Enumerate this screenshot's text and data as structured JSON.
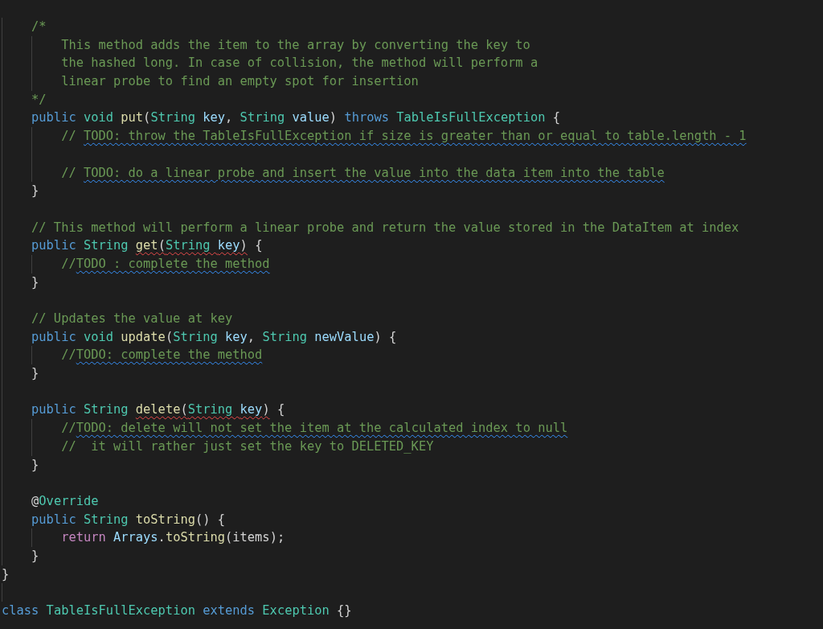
{
  "editor": {
    "lines": [
      {
        "tokens": [
          {
            "text": "    /*",
            "kind": "comment",
            "squiggle": false
          }
        ]
      },
      {
        "tokens": [
          {
            "text": "        This method adds the item to the array by converting the key to",
            "kind": "comment",
            "squiggle": false
          }
        ]
      },
      {
        "tokens": [
          {
            "text": "        the hashed long. In case of collision, the method will perform a",
            "kind": "comment",
            "squiggle": false
          }
        ]
      },
      {
        "tokens": [
          {
            "text": "        linear probe to find an empty spot for insertion",
            "kind": "comment",
            "squiggle": false
          }
        ]
      },
      {
        "tokens": [
          {
            "text": "    */",
            "kind": "comment",
            "squiggle": false
          }
        ]
      },
      {
        "tokens": [
          {
            "text": "    public ",
            "kind": "keyword",
            "squiggle": false
          },
          {
            "text": "void ",
            "kind": "type",
            "squiggle": false
          },
          {
            "text": "put",
            "kind": "function",
            "squiggle": false
          },
          {
            "text": "(",
            "kind": "plain",
            "squiggle": false
          },
          {
            "text": "String ",
            "kind": "type",
            "squiggle": false
          },
          {
            "text": "key",
            "kind": "variable",
            "squiggle": false
          },
          {
            "text": ", ",
            "kind": "plain",
            "squiggle": false
          },
          {
            "text": "String ",
            "kind": "type",
            "squiggle": false
          },
          {
            "text": "value",
            "kind": "variable",
            "squiggle": false
          },
          {
            "text": ") ",
            "kind": "plain",
            "squiggle": false
          },
          {
            "text": "throws ",
            "kind": "keyword",
            "squiggle": false
          },
          {
            "text": "TableIsFullException",
            "kind": "type",
            "squiggle": false
          },
          {
            "text": " {",
            "kind": "plain",
            "squiggle": false
          }
        ]
      },
      {
        "tokens": [
          {
            "text": "        // ",
            "kind": "comment",
            "squiggle": false
          },
          {
            "text": "TODO: throw the TableIsFullException if size is greater than or equal to table.length - 1",
            "kind": "comment",
            "squiggle": true,
            "error": false
          }
        ]
      },
      {
        "in_method": true
      },
      {
        "tokens": [
          {
            "text": "        // ",
            "kind": "comment",
            "squiggle": false
          },
          {
            "text": "TODO: do a linear probe and insert the value into the data item into the table",
            "kind": "comment",
            "squiggle": true,
            "error": false
          }
        ]
      },
      {
        "tokens": [
          {
            "text": "    }",
            "kind": "plain",
            "squiggle": false
          }
        ]
      },
      {
        "in_method": false
      },
      {
        "tokens": [
          {
            "text": "    // This method will perform a linear probe and return the value stored in the DataItem at index",
            "kind": "comment",
            "squiggle": false
          }
        ]
      },
      {
        "tokens": [
          {
            "text": "    public ",
            "kind": "keyword",
            "squiggle": false
          },
          {
            "text": "String ",
            "kind": "type",
            "squiggle": false
          },
          {
            "text": "get",
            "kind": "function",
            "squiggle": true,
            "error": true
          },
          {
            "text": "(",
            "kind": "plain",
            "squiggle": true,
            "error": true
          },
          {
            "text": "String ",
            "kind": "type",
            "squiggle": true,
            "error": true
          },
          {
            "text": "key",
            "kind": "variable",
            "squiggle": true,
            "error": true
          },
          {
            "text": ")",
            "kind": "plain",
            "squiggle": true,
            "error": true
          },
          {
            "text": " {",
            "kind": "plain",
            "squiggle": false
          }
        ]
      },
      {
        "tokens": [
          {
            "text": "        //",
            "kind": "comment",
            "squiggle": false
          },
          {
            "text": "TODO : complete the method",
            "kind": "comment",
            "squiggle": true,
            "error": false
          }
        ]
      },
      {
        "tokens": [
          {
            "text": "    }",
            "kind": "plain",
            "squiggle": false
          }
        ]
      },
      {
        "in_method": false
      },
      {
        "tokens": [
          {
            "text": "    // Updates the value at key",
            "kind": "comment",
            "squiggle": false
          }
        ]
      },
      {
        "tokens": [
          {
            "text": "    public ",
            "kind": "keyword",
            "squiggle": false
          },
          {
            "text": "void ",
            "kind": "type",
            "squiggle": false
          },
          {
            "text": "update",
            "kind": "function",
            "squiggle": false
          },
          {
            "text": "(",
            "kind": "plain",
            "squiggle": false
          },
          {
            "text": "String ",
            "kind": "type",
            "squiggle": false
          },
          {
            "text": "key",
            "kind": "variable",
            "squiggle": false
          },
          {
            "text": ", ",
            "kind": "plain",
            "squiggle": false
          },
          {
            "text": "String ",
            "kind": "type",
            "squiggle": false
          },
          {
            "text": "newValue",
            "kind": "variable",
            "squiggle": false
          },
          {
            "text": ") {",
            "kind": "plain",
            "squiggle": false
          }
        ]
      },
      {
        "tokens": [
          {
            "text": "        //",
            "kind": "comment",
            "squiggle": false
          },
          {
            "text": "TODO: complete the method",
            "kind": "comment",
            "squiggle": true,
            "error": false
          }
        ]
      },
      {
        "tokens": [
          {
            "text": "    }",
            "kind": "plain",
            "squiggle": false
          }
        ]
      },
      {
        "in_method": false
      },
      {
        "tokens": [
          {
            "text": "    public ",
            "kind": "keyword",
            "squiggle": false
          },
          {
            "text": "String ",
            "kind": "type",
            "squiggle": false
          },
          {
            "text": "delete",
            "kind": "function",
            "squiggle": true,
            "error": true
          },
          {
            "text": "(",
            "kind": "plain",
            "squiggle": true,
            "error": true
          },
          {
            "text": "String ",
            "kind": "type",
            "squiggle": true,
            "error": true
          },
          {
            "text": "key",
            "kind": "variable",
            "squiggle": true,
            "error": true
          },
          {
            "text": ")",
            "kind": "plain",
            "squiggle": true,
            "error": true
          },
          {
            "text": " {",
            "kind": "plain",
            "squiggle": false
          }
        ]
      },
      {
        "tokens": [
          {
            "text": "        //",
            "kind": "comment",
            "squiggle": false
          },
          {
            "text": "TODO: delete will not set the item at the calculated index to null",
            "kind": "comment",
            "squiggle": true,
            "error": false
          }
        ]
      },
      {
        "tokens": [
          {
            "text": "        //  it will rather just set the key to DELETED_KEY",
            "kind": "comment",
            "squiggle": false
          }
        ]
      },
      {
        "tokens": [
          {
            "text": "    }",
            "kind": "plain",
            "squiggle": false
          }
        ]
      },
      {
        "in_method": false
      },
      {
        "tokens": [
          {
            "text": "    @",
            "kind": "plain",
            "squiggle": false
          },
          {
            "text": "Override",
            "kind": "type",
            "squiggle": false
          }
        ]
      },
      {
        "tokens": [
          {
            "text": "    public ",
            "kind": "keyword",
            "squiggle": false
          },
          {
            "text": "String ",
            "kind": "type",
            "squiggle": false
          },
          {
            "text": "toString",
            "kind": "function",
            "squiggle": false
          },
          {
            "text": "() {",
            "kind": "plain",
            "squiggle": false
          }
        ]
      },
      {
        "tokens": [
          {
            "text": "        return ",
            "kind": "control",
            "squiggle": false
          },
          {
            "text": "Arrays",
            "kind": "variable",
            "squiggle": false
          },
          {
            "text": ".",
            "kind": "plain",
            "squiggle": false
          },
          {
            "text": "toString",
            "kind": "function",
            "squiggle": false
          },
          {
            "text": "(items);",
            "kind": "plain",
            "squiggle": false
          }
        ]
      },
      {
        "tokens": [
          {
            "text": "    }",
            "kind": "plain",
            "squiggle": false
          }
        ]
      },
      {
        "tokens": [
          {
            "text": "}",
            "kind": "plain",
            "squiggle": false
          }
        ]
      },
      {
        "in_method": false
      },
      {
        "tokens": [
          {
            "text": "class ",
            "kind": "keyword",
            "squiggle": false
          },
          {
            "text": "TableIsFullException ",
            "kind": "type",
            "squiggle": false
          },
          {
            "text": "extends ",
            "kind": "keyword",
            "squiggle": false
          },
          {
            "text": "Exception",
            "kind": "type",
            "squiggle": false
          },
          {
            "text": " {}",
            "kind": "plain",
            "squiggle": false
          }
        ]
      }
    ]
  }
}
